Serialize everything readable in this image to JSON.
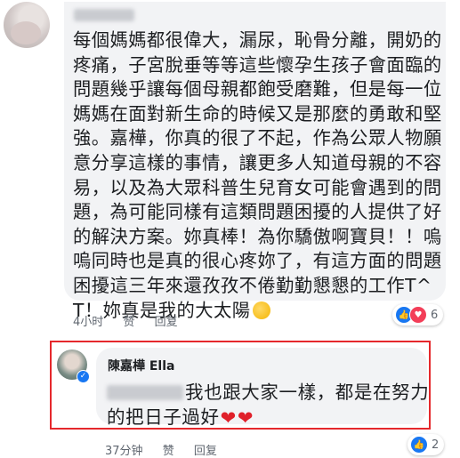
{
  "comment1": {
    "text": "每個媽媽都很偉大，漏尿，恥骨分離，開奶的疼痛，子宮脫垂等等這些懷孕生孩子會面臨的問題幾乎讓每個母親都飽受磨難，但是每一位媽媽在面對新生命的時候又是那麼的勇敢和堅強。嘉樺，你真的很了不起，作為公眾人物願意分享這樣的事情，讓更多人知道母親的不容易，以及為大眾科普生兒育女可能會遇到的問題，為可能同樣有這類問題困擾的人提供了好的解決方案。妳真棒！為你驕傲啊寶貝！！嗚嗚同時也是真的很心疼妳了，有這方面的問題困擾這三年來還孜孜不倦勤勤懇懇的工作T^T！妳真是我的大太陽",
    "emoji": "sun-face",
    "time": "4小时",
    "like_label": "赞",
    "reply_label": "回复",
    "reaction_count": "6",
    "reactions": [
      "like",
      "love"
    ]
  },
  "comment2": {
    "author": "陳嘉樺 Ella",
    "line1": "我也跟大家一樣，都是在努力",
    "line2": "的把日子過好",
    "emoji": "red-heart",
    "time": "37分钟",
    "like_label": "赞",
    "reply_label": "回复",
    "reaction_count": "2",
    "reactions": [
      "like"
    ]
  },
  "colors": {
    "highlight": "#e5282c",
    "bubble": "#f2f3f5",
    "like": "#1877f2",
    "love": "#f33e58"
  }
}
